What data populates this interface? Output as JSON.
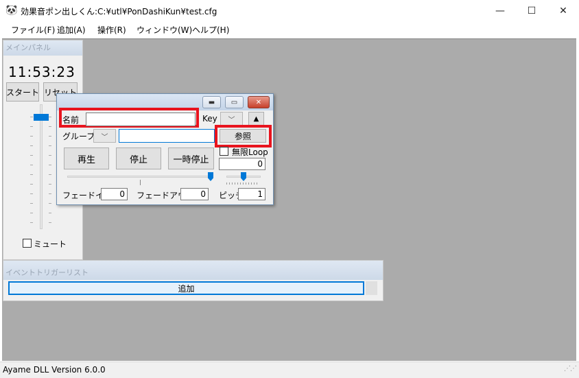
{
  "window": {
    "title": "効果音ポン出しくん:C:¥utl¥PonDashiKun¥test.cfg",
    "app_icon": "panda-app-icon",
    "minimize_glyph": "—",
    "maximize_glyph": "☐",
    "close_glyph": "✕"
  },
  "menu": {
    "items": [
      {
        "label": "ファイル(F)"
      },
      {
        "label": "追加(A)"
      },
      {
        "label": "操作(R)"
      },
      {
        "label": "ウィンドウ(W)"
      },
      {
        "label": "ヘルプ(H)"
      }
    ]
  },
  "main_panel": {
    "caption": "メインパネル",
    "clock": "11:53:23",
    "start_label": "スタート",
    "reset_label": "リセット",
    "volume_level": 0.9,
    "mute_label": "ミュート",
    "mute_checked": false
  },
  "sound_window": {
    "minimize_glyph": "▬",
    "maximize_glyph": "▭",
    "close_glyph": "✕",
    "name_label": "名前",
    "name_value": "",
    "key_label": "Key",
    "key_dropdown": "﹀",
    "up_glyph": "▲",
    "group_label": "グループ",
    "group_dropdown": "﹀",
    "group_value": "",
    "browse_label": "参照",
    "loop_label": "無限Loop",
    "loop_checked": false,
    "loop_count": "0",
    "play_label": "再生",
    "stop_label": "停止",
    "pause_label": "一時停止",
    "volume_slider_level": 1.0,
    "pitch_slider_level": 0.5,
    "fadein_label": "フェードイン",
    "fadein_value": "0",
    "fadeout_label": "フェードアウト",
    "fadeout_value": "0",
    "pitch_label": "ピッチ",
    "pitch_value": "1"
  },
  "event_panel": {
    "caption": "イベントトリガーリスト",
    "add_label": "追加"
  },
  "status": {
    "text": "Ayame DLL Version 6.0.0"
  },
  "colors": {
    "accent": "#0078d7",
    "highlight_box": "#e8141e",
    "mdi_background": "#ababab"
  }
}
